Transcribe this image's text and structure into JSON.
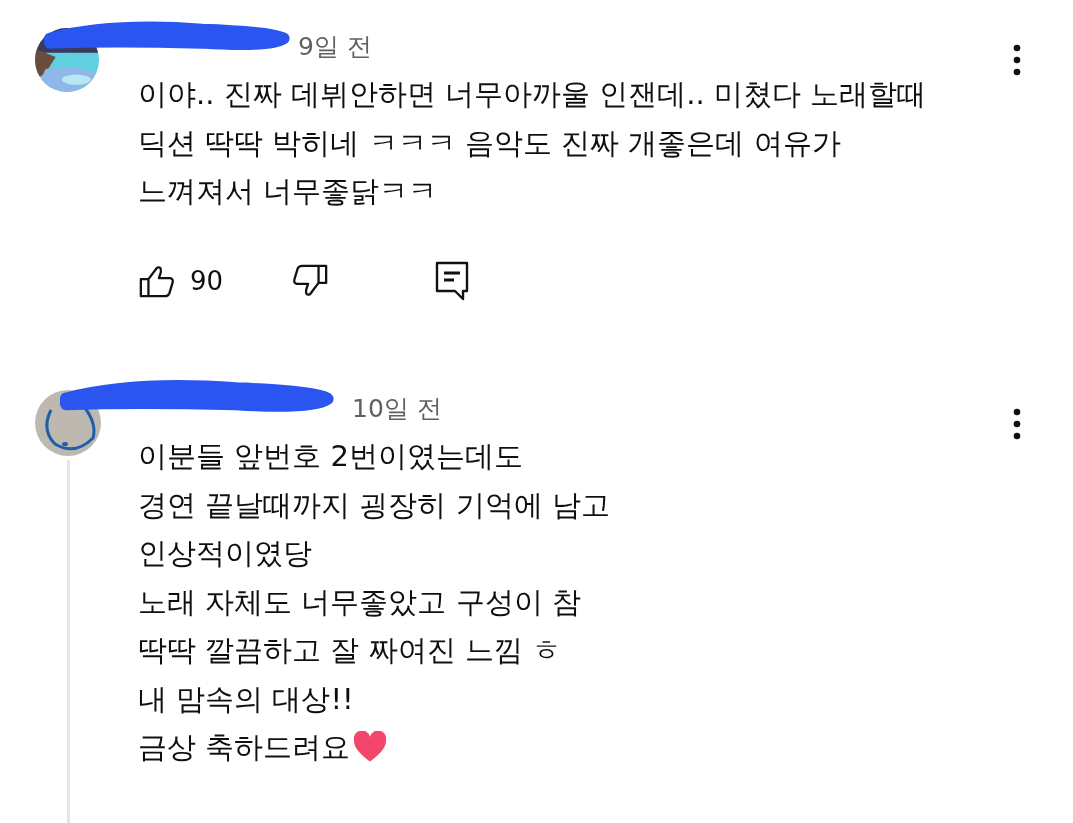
{
  "comments": [
    {
      "time": "9일 전",
      "lines": [
        "이야.. 진짜 데뷔안하면 너무아까울 인잰데.. 미쳤다 노래할때",
        "딕션 딱딱 박히네 ㅋㅋㅋ 음악도 진짜 개좋은데 여유가",
        "느껴져서 너무좋닭ㅋㅋ"
      ],
      "likes": "90",
      "heart_end": false,
      "thread": false
    },
    {
      "avatar": {
        "kind": "drawing"
      },
      "time": "10일 전",
      "lines": [
        "이분들 앞번호 2번이였는데도",
        "경연 끝날때까지 굉장히 기억에 남고",
        "인상적이였당",
        "노래 자체도 너무좋았고 구성이 참",
        "딱딱 깔끔하고 잘 짜여진 느낌 ㅎ",
        "내 맘속의 대상!!",
        "금상 축하드려요"
      ],
      "heart_end": true,
      "thread": true
    }
  ]
}
